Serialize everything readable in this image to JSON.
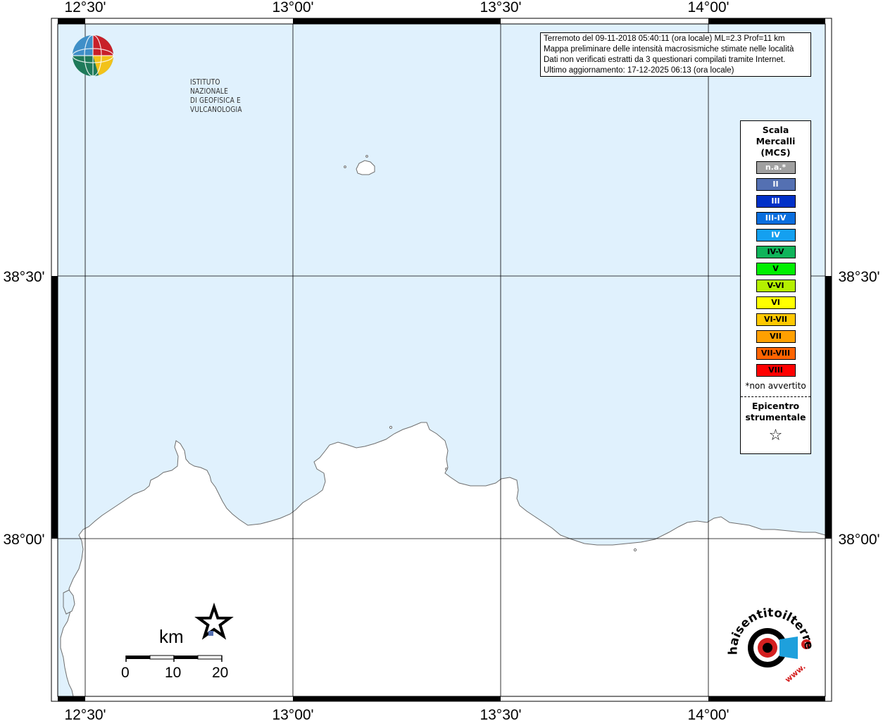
{
  "map": {
    "longitude_labels": [
      "12°30'",
      "13°00'",
      "13°30'",
      "14°00'"
    ],
    "latitude_labels": [
      "38°30'",
      "38°00'"
    ],
    "colors": {
      "sea": "#e0f1fd",
      "land": "#ffffff",
      "coast": "#6e6e6e",
      "grid": "#000000"
    }
  },
  "info": {
    "line1": "Terremoto del 09-11-2018 05:40:11 (ora locale) ML=2.3 Prof=11 km",
    "line2": "Mappa preliminare delle intensità macrosismiche stimate nelle località",
    "line3": "Dati non verificati estratti da 3 questionari compilati tramite Internet.",
    "line4": "Ultimo aggiornamento: 17-12-2025 06:13 (ora locale)"
  },
  "legend": {
    "title_line1": "Scala",
    "title_line2": "Mercalli",
    "title_line3": "(MCS)",
    "items": [
      {
        "label": "n.a.*",
        "color": "#a0a0a0"
      },
      {
        "label": "II",
        "color": "#5470b2"
      },
      {
        "label": "III",
        "color": "#0030c8"
      },
      {
        "label": "III-IV",
        "color": "#0a6ede"
      },
      {
        "label": "IV",
        "color": "#14a0f0"
      },
      {
        "label": "IV-V",
        "color": "#0fb45a"
      },
      {
        "label": "V",
        "color": "#00f000"
      },
      {
        "label": "V-VI",
        "color": "#b4f000"
      },
      {
        "label": "VI",
        "color": "#ffff00"
      },
      {
        "label": "VI-VII",
        "color": "#ffc800"
      },
      {
        "label": "VII",
        "color": "#ffa000"
      },
      {
        "label": "VII-VIII",
        "color": "#ff6400"
      },
      {
        "label": "VIII",
        "color": "#ff0000"
      }
    ],
    "note": "*non avvertito",
    "epicenter_line1": "Epicentro",
    "epicenter_line2": "strumentale",
    "star_icon": "star-outline-icon"
  },
  "scalebar": {
    "unit": "km",
    "labels": [
      "0",
      "10",
      "20"
    ]
  },
  "logos": {
    "ingv_line1": "ISTITUTO NAZIONALE",
    "ingv_line2": "DI GEOFISICA E VULCANOLOGIA",
    "hst_name": "haisentitoilterremoto.it",
    "hst_www": "www.",
    "hst_q": "?"
  }
}
